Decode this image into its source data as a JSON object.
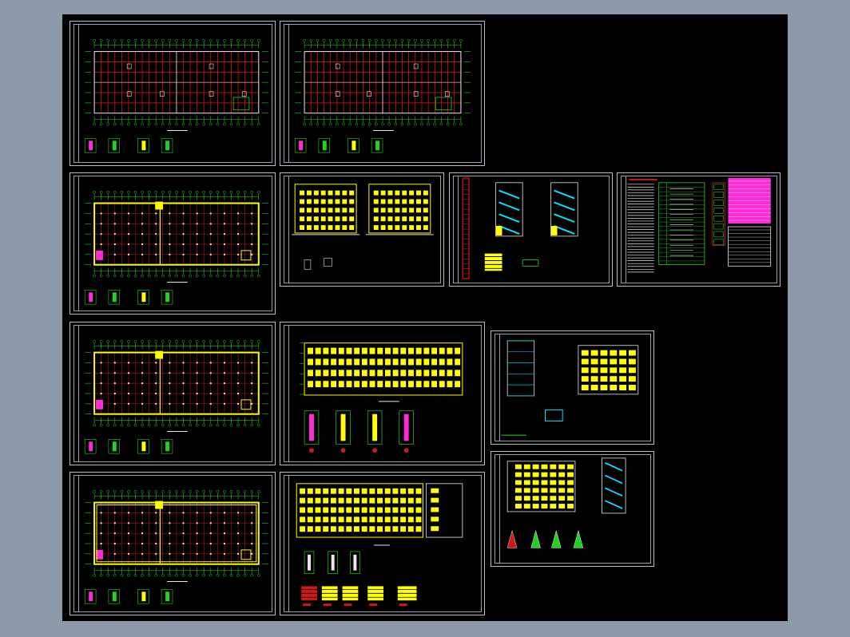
{
  "app": {
    "viewport_name": "cad-model-space",
    "background_color": "#000000",
    "frame_color": "#b8bcc4"
  },
  "colors": {
    "grid_red": "#d01818",
    "axis_green": "#21d321",
    "wall_yellow": "#ffff00",
    "stair_cyan": "#00e5ff",
    "magenta": "#ff2bd6",
    "text_white": "#e8e8e8"
  },
  "sheets": [
    {
      "id": "plan-roof-1",
      "kind": "floor-plan"
    },
    {
      "id": "plan-roof-2",
      "kind": "floor-plan"
    },
    {
      "id": "plan-floor-2",
      "kind": "floor-plan"
    },
    {
      "id": "elevation-side-pair",
      "kind": "elevation"
    },
    {
      "id": "stair-sections",
      "kind": "section"
    },
    {
      "id": "design-notes-tables",
      "kind": "notes"
    },
    {
      "id": "plan-floor-3",
      "kind": "floor-plan"
    },
    {
      "id": "elevation-front",
      "kind": "elevation"
    },
    {
      "id": "section-elevation-pair",
      "kind": "elevation"
    },
    {
      "id": "plan-floor-1",
      "kind": "floor-plan"
    },
    {
      "id": "elevation-rear",
      "kind": "elevation"
    },
    {
      "id": "elevation-stair-pair",
      "kind": "elevation"
    }
  ]
}
